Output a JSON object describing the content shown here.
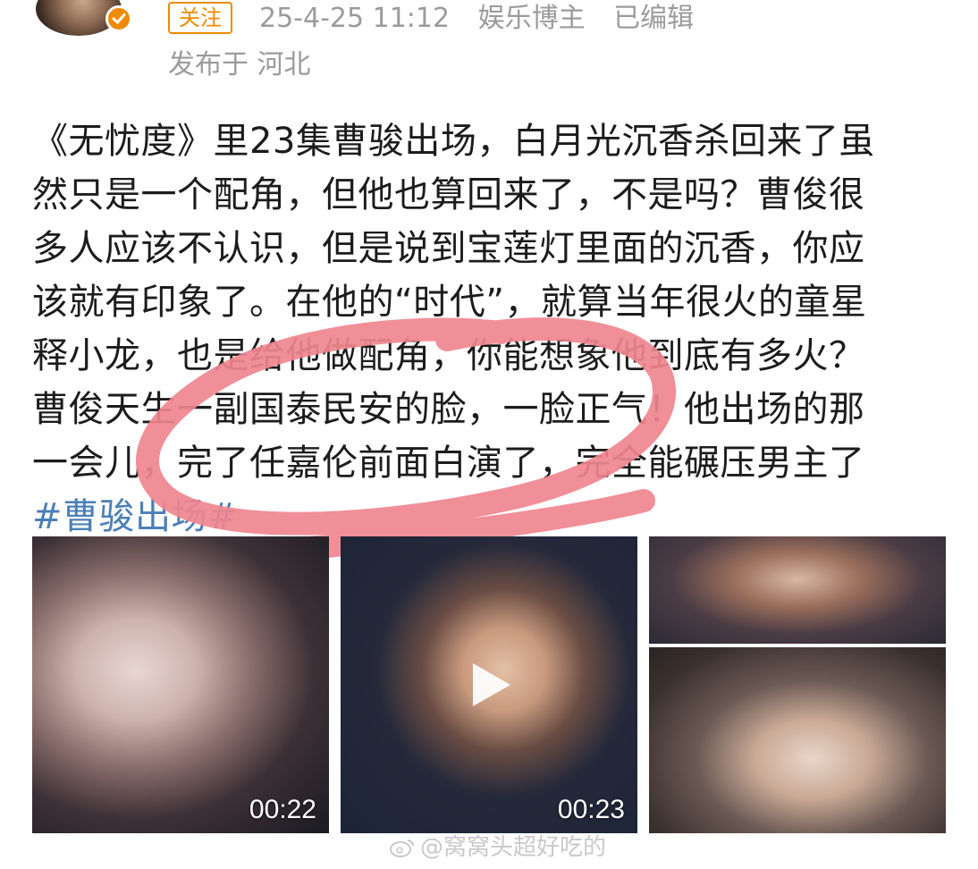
{
  "header": {
    "follow_label": "关注",
    "timestamp": "25-4-25 11:12",
    "category": "娱乐博主",
    "edited": "已编辑",
    "location": "发布于 河北"
  },
  "post": {
    "lines": [
      "《无忧度》里23集曹骏出场，白月光沉香杀回来了虽",
      "然只是一个配角，但他也算回来了，不是吗？曹俊很",
      "多人应该不认识，但是说到宝莲灯里面的沉香，你应",
      "该就有印象了。在他的“时代”，就算当年很火的童星",
      "释小龙，也是给他做配角，你能想象他到底有多火？",
      "曹俊天生一副国泰民安的脸，一脸正气！他出场的那",
      "一会儿，完了任嘉伦前面白演了，完全能碾压男主了"
    ],
    "hashtag": "#曹骏出场#"
  },
  "media": {
    "video1_duration": "00:22",
    "video2_duration": "00:23"
  },
  "watermark": {
    "text": "@窝窝头超好吃的"
  },
  "colors": {
    "accent_orange": "#f08a00",
    "hashtag_blue": "#4b7fb8",
    "annotation_pink": "#f0858f",
    "meta_gray": "#9b9b9b"
  },
  "icons": {
    "verified": "verified-badge-icon",
    "play": "play-icon",
    "weibo": "weibo-logo-icon"
  }
}
